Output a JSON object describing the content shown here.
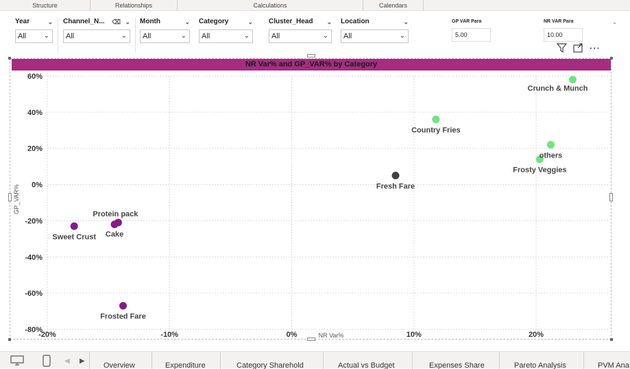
{
  "ribbon": {
    "groups": [
      "Structure",
      "Relationships",
      "Calculations",
      "Calendars"
    ]
  },
  "slicers": [
    {
      "title": "Year",
      "value": "All"
    },
    {
      "title": "Channel_N...",
      "value": "All"
    },
    {
      "title": "Month",
      "value": "All"
    },
    {
      "title": "Category",
      "value": "All"
    },
    {
      "title": "Cluster_Head",
      "value": "All"
    },
    {
      "title": "Location",
      "value": "All"
    }
  ],
  "params": [
    {
      "title": "GP VAR Para",
      "value": "5.00"
    },
    {
      "title": "NR VAR Para",
      "value": "10.00"
    }
  ],
  "icons": {
    "filter": "filter-icon",
    "focus": "focus-mode-icon",
    "more": "more-options-icon",
    "eraser": "clear-selections-icon"
  },
  "visual": {
    "title": "NR Var% and GP_VAR% by Category"
  },
  "chart_data": {
    "type": "scatter",
    "title": "NR Var% and GP_VAR% by Category",
    "xlabel": "NR Var%",
    "ylabel": "GP_VAR%",
    "xlim": [
      -20,
      26
    ],
    "ylim": [
      -80,
      60
    ],
    "x_ticks": [
      "-20%",
      "-10%",
      "0%",
      "10%",
      "20%"
    ],
    "y_ticks": [
      "60%",
      "40%",
      "20%",
      "0%",
      "-20%",
      "-40%",
      "-60%",
      "-80%"
    ],
    "grid": true,
    "colors": {
      "high": "#6ee57e",
      "neutral": "#404040",
      "low": "#861a86"
    },
    "points": [
      {
        "label": "Crunch & Munch",
        "x": 23.0,
        "y": 58,
        "group": "high"
      },
      {
        "label": "Country Fries",
        "x": 11.8,
        "y": 36,
        "group": "high"
      },
      {
        "label": "others",
        "x": 21.2,
        "y": 22,
        "group": "high"
      },
      {
        "label": "Frosty Veggies",
        "x": 20.3,
        "y": 14,
        "group": "high"
      },
      {
        "label": "Fresh Fare",
        "x": 8.5,
        "y": 5,
        "group": "neutral"
      },
      {
        "label": "Protein pack",
        "x": -14.2,
        "y": -21,
        "group": "low"
      },
      {
        "label": "Cake",
        "x": -14.5,
        "y": -22,
        "group": "low"
      },
      {
        "label": "Sweet Crust",
        "x": -17.8,
        "y": -23,
        "group": "low"
      },
      {
        "label": "Frosted Fare",
        "x": -13.8,
        "y": -67,
        "group": "low"
      }
    ]
  },
  "pages": [
    "Overview",
    "Expenditure",
    "Category Sharehold",
    "Actual vs Budget",
    "Expenses Share",
    "Pareto Analysis",
    "PVM Ana"
  ]
}
